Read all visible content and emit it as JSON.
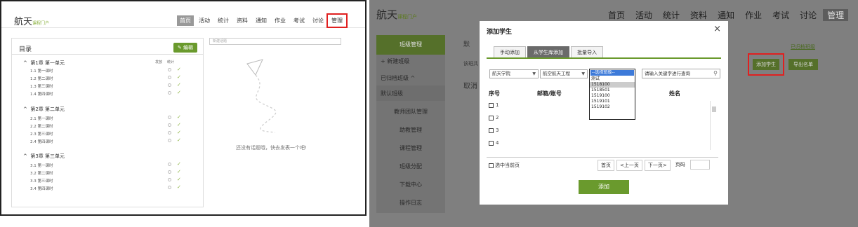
{
  "left": {
    "logo": "航天",
    "logo_sub": "课程门户",
    "nav": [
      "首页",
      "活动",
      "统计",
      "资料",
      "通知",
      "作业",
      "考试",
      "讨论",
      "管理"
    ],
    "catalog": {
      "title": "目录",
      "edit": "编辑",
      "col_publish": "发放",
      "col_stats": "统计",
      "chapters": [
        {
          "label": "第1章 第一单元",
          "lessons": [
            "1.1  第一课时",
            "1.2  第二课时",
            "1.3  第三课时",
            "1.4  第四课时"
          ]
        },
        {
          "label": "第2章 第二单元",
          "lessons": [
            "2.1  第一课时",
            "2.2  第二课时",
            "2.3  第三课时",
            "2.4  第四课时"
          ]
        },
        {
          "label": "第3章 第三单元",
          "lessons": [
            "3.1  第一课时",
            "3.2  第二课时",
            "3.3  第三课时",
            "3.4  第四课时"
          ]
        }
      ]
    },
    "discuss_placeholder": "新建话题",
    "empty_text": "还没有话题哦，快去发表一个吧!"
  },
  "right": {
    "logo": "航天",
    "logo_sub": "课程门户",
    "nav": [
      "首页",
      "活动",
      "统计",
      "资料",
      "通知",
      "作业",
      "考试",
      "讨论",
      "管理"
    ],
    "sidebar": {
      "head": "班级管理",
      "new_class": "+ 新建班级",
      "archived": "已归档班级 ^",
      "default_class": "默认班级",
      "items": [
        "教师团队管理",
        "助教管理",
        "课程管理",
        "班级分配",
        "下载中心",
        "操作日志"
      ]
    },
    "bg": {
      "title": "默",
      "archive_link": "已归档班级",
      "line2": "该班共",
      "line3": "取消",
      "add_student": "添加学生",
      "export": "导出名单"
    },
    "modal": {
      "title": "添加学生",
      "close": "×",
      "tabs": [
        "手动添加",
        "从学生库添加",
        "批量导入"
      ],
      "school": "航天学院",
      "major": "航空航天工程",
      "grade_options": [
        "--选择班级--",
        "测试",
        "1518100",
        "1518501",
        "1519100",
        "1519101",
        "1519102"
      ],
      "search_placeholder": "请输入关键字进行查询",
      "col_no": "序号",
      "col_account": "邮箱/账号",
      "col_name": "姓名",
      "rows": [
        "1",
        "2",
        "3",
        "4"
      ],
      "select_page": "选中当前页",
      "pager": [
        "首页",
        "<上一页",
        "下一页>",
        "页码"
      ],
      "add": "添加"
    }
  }
}
